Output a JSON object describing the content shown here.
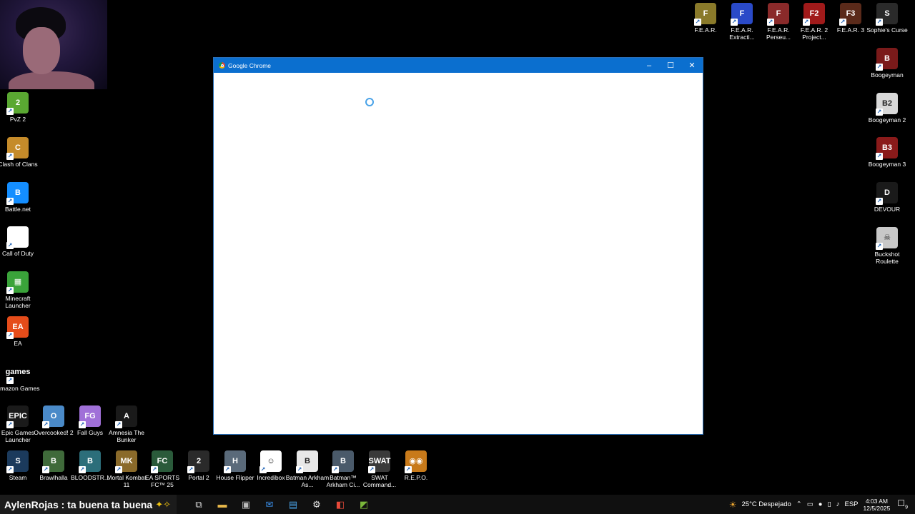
{
  "window": {
    "title": "Google Chrome",
    "minimize_glyph": "–",
    "maximize_glyph": "☐",
    "close_glyph": "✕"
  },
  "desktop_icons_left": [
    {
      "label": "PvZ 2",
      "icon": "pvz2-icon",
      "color": "#5aa832",
      "glyph": "2"
    },
    {
      "label": "Clash of Clans",
      "icon": "clash-of-clans-icon",
      "color": "#c58b2a",
      "glyph": "C"
    },
    {
      "label": "Battle.net",
      "icon": "battle-net-icon",
      "color": "#148eff",
      "glyph": "B"
    },
    {
      "label": "Call of Duty",
      "icon": "file-icon",
      "color": "#ffffff",
      "glyph": ""
    },
    {
      "label": "Minecraft Launcher",
      "icon": "minecraft-icon",
      "color": "#3aa33a",
      "glyph": "▦"
    },
    {
      "label": "EA",
      "icon": "ea-icon",
      "color": "#e54c1a",
      "glyph": "EA"
    },
    {
      "label": "Amazon Games",
      "icon": "amazon-games-icon",
      "color": "#000000",
      "glyph": "games"
    },
    {
      "label": "Epic Games Launcher",
      "icon": "epic-games-icon",
      "color": "#1a1a1a",
      "glyph": "EPIC"
    }
  ],
  "desktop_icons_bottom": [
    {
      "label": "Steam",
      "icon": "steam-icon",
      "color": "#1b3a5c",
      "glyph": "S"
    },
    {
      "label": "Brawlhalla",
      "icon": "brawlhalla-icon",
      "color": "#3f6a3a",
      "glyph": "B"
    },
    {
      "label": "BLOODSTR...",
      "icon": "bloodstained-icon",
      "color": "#2c6e7a",
      "glyph": "B"
    },
    {
      "label": "Mortal Kombat 11",
      "icon": "mortal-kombat-icon",
      "color": "#8a6a2a",
      "glyph": "MK"
    },
    {
      "label": "EA SPORTS FC™ 25",
      "icon": "ea-fc-icon",
      "color": "#2a5a3a",
      "glyph": "FC"
    },
    {
      "label": "Portal 2",
      "icon": "portal2-icon",
      "color": "#2a2a2a",
      "glyph": "2"
    },
    {
      "label": "House Flipper",
      "icon": "house-flipper-icon",
      "color": "#5a6a7a",
      "glyph": "H"
    },
    {
      "label": "Incredibox",
      "icon": "incredibox-icon",
      "color": "#ffffff",
      "glyph": "☺"
    },
    {
      "label": "Batman Arkham As...",
      "icon": "batman-asylum-icon",
      "color": "#e8e8e8",
      "glyph": "B"
    },
    {
      "label": "Batman™ Arkham Ci...",
      "icon": "batman-city-icon",
      "color": "#4a5a6a",
      "glyph": "B"
    },
    {
      "label": "SWAT Command...",
      "icon": "swat-icon",
      "color": "#3a3a3a",
      "glyph": "SWAT"
    },
    {
      "label": "R.E.P.O.",
      "icon": "repo-icon",
      "color": "#c87a1a",
      "glyph": "◉◉"
    }
  ],
  "desktop_icons_mid_bottom": [
    {
      "label": "Overcooked! 2",
      "icon": "overcooked-icon",
      "color": "#4a8ac8",
      "glyph": "O"
    },
    {
      "label": "Fall Guys",
      "icon": "fall-guys-icon",
      "color": "#a070d8",
      "glyph": "FG"
    },
    {
      "label": "Amnesia The Bunker",
      "icon": "amnesia-icon",
      "color": "#1a1a1a",
      "glyph": "A"
    }
  ],
  "desktop_icons_top_right": [
    {
      "label": "F.E.A.R.",
      "icon": "fear-icon",
      "color": "#8a7a2a",
      "glyph": "F"
    },
    {
      "label": "F.E.A.R. Extracti...",
      "icon": "fear-extraction-icon",
      "color": "#2a4ac8",
      "glyph": "F"
    },
    {
      "label": "F.E.A.R. Perseu...",
      "icon": "fear-perseus-icon",
      "color": "#8a2a2a",
      "glyph": "F"
    },
    {
      "label": "F.E.A.R. 2 Project...",
      "icon": "fear2-icon",
      "color": "#a01a1a",
      "glyph": "F2"
    },
    {
      "label": "F.E.A.R. 3",
      "icon": "fear3-icon",
      "color": "#5a2a1a",
      "glyph": "F3"
    },
    {
      "label": "Sophie's Curse",
      "icon": "sophies-curse-icon",
      "color": "#2a2a2a",
      "glyph": "S"
    }
  ],
  "desktop_icons_right": [
    {
      "label": "Boogeyman",
      "icon": "boogeyman-icon",
      "color": "#7a1a1a",
      "glyph": "B"
    },
    {
      "label": "Boogeyman 2",
      "icon": "boogeyman2-icon",
      "color": "#d8d8d8",
      "glyph": "B2"
    },
    {
      "label": "Boogeyman 3",
      "icon": "boogeyman3-icon",
      "color": "#8a1a1a",
      "glyph": "B3"
    },
    {
      "label": "DEVOUR",
      "icon": "devour-icon",
      "color": "#1a1a1a",
      "glyph": "D"
    },
    {
      "label": "Buckshot Roulette",
      "icon": "buckshot-roulette-icon",
      "color": "#c8c8c8",
      "glyph": "☠"
    }
  ],
  "taskbar": {
    "overlay_text": "AylenRojas : ta buena ta buena",
    "overlay_sparkles": "✦✧",
    "weather": "25°C  Despejado",
    "language": "ESP",
    "time": "4:03 AM",
    "date": "12/5/2025",
    "notification_count": "9"
  }
}
